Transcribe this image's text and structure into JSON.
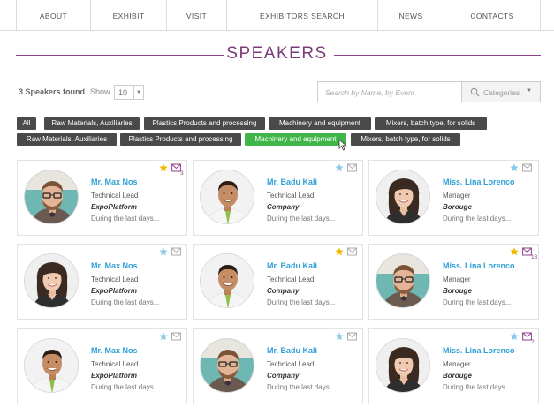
{
  "nav": {
    "items": [
      "ABOUT",
      "EXHIBIT",
      "VISIT",
      "EXHIBITORS SEARCH",
      "NEWS",
      "CONTACTS"
    ]
  },
  "page_title": "SPEAKERS",
  "toolbar": {
    "found_text": "3 Speakers found",
    "show_label": "Show",
    "show_value": "10",
    "search_placeholder": "Search by Name, by Event",
    "categories_label": "Categories"
  },
  "tags": {
    "row1": [
      "All",
      "Raw Materials, Auxiliaries",
      "Plastics Products and processing",
      "Machinery and equipment",
      "Mixers, batch type, for solids"
    ],
    "row2": [
      "Raw Materials, Auxiliaries",
      "Plastics Products and processing",
      "Machinery and equipment",
      "Mixers, batch type, for solids"
    ],
    "active_row2_index": 2
  },
  "colors": {
    "accent_purple": "#7b3a79",
    "link_blue": "#2ea0d6",
    "tag_dark": "#4a4a4a",
    "tag_active": "#3fb54a",
    "star_gold": "#f5b800",
    "star_blue": "#8ec9ea"
  },
  "cards": [
    {
      "name": "Mr. Max Nos",
      "role": "Technical Lead",
      "company": "ExpoPlatform",
      "desc": "During the last days...",
      "avatar": "man-glasses",
      "star": "gold",
      "mail_count": "3"
    },
    {
      "name": "Mr. Badu Kali",
      "role": "Technical Lead",
      "company": "Company",
      "desc": "During the last days...",
      "avatar": "man-smiling",
      "star": "blue",
      "mail_count": ""
    },
    {
      "name": "Miss. Lina Lorenco",
      "role": "Manager",
      "company": "Borouge",
      "desc": "During the last days...",
      "avatar": "woman",
      "star": "blue",
      "mail_count": ""
    },
    {
      "name": "Mr. Max Nos",
      "role": "Technical Lead",
      "company": "ExpoPlatform",
      "desc": "During the last days...",
      "avatar": "woman",
      "star": "blue",
      "mail_count": ""
    },
    {
      "name": "Mr. Badu Kali",
      "role": "Technical Lead",
      "company": "Company",
      "desc": "During the last days...",
      "avatar": "man-smiling",
      "star": "gold",
      "mail_count": ""
    },
    {
      "name": "Miss. Lina Lorenco",
      "role": "Manager",
      "company": "Borouge",
      "desc": "During the last days...",
      "avatar": "man-glasses",
      "star": "gold",
      "mail_count": "13"
    },
    {
      "name": "Mr. Max Nos",
      "role": "Technical Lead",
      "company": "ExpoPlatform",
      "desc": "During the last days...",
      "avatar": "man-smiling",
      "star": "blue",
      "mail_count": ""
    },
    {
      "name": "Mr. Badu Kali",
      "role": "Technical Lead",
      "company": "Company",
      "desc": "During the last days...",
      "avatar": "man-glasses",
      "star": "blue",
      "mail_count": ""
    },
    {
      "name": "Miss. Lina Lorenco",
      "role": "Manager",
      "company": "Borouge",
      "desc": "During the last days...",
      "avatar": "woman",
      "star": "blue",
      "mail_count": "2"
    }
  ]
}
